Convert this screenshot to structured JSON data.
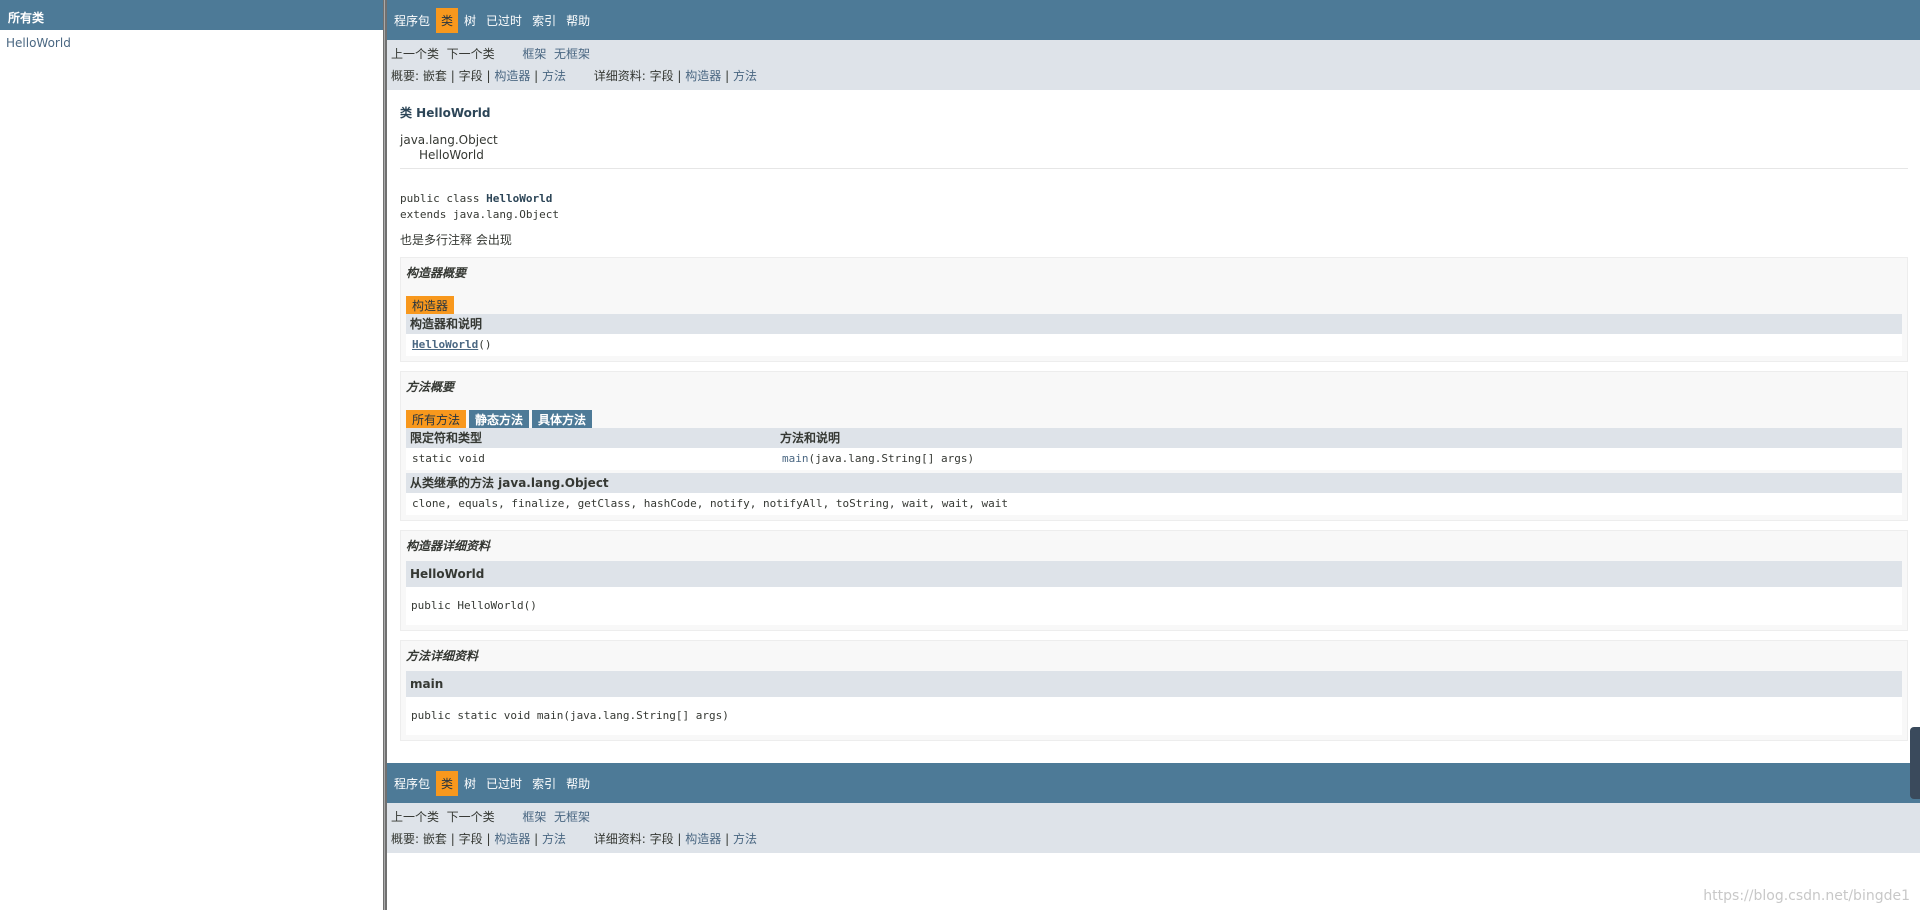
{
  "left": {
    "header": "所有类",
    "classes": [
      "HelloWorld"
    ]
  },
  "nav": {
    "items": [
      "程序包",
      "类",
      "树",
      "已过时",
      "索引",
      "帮助"
    ],
    "active_index": 1,
    "prev_class": "上一个类",
    "next_class": "下一个类",
    "frames": "框架",
    "no_frames": "无框架",
    "summary_label": "概要:",
    "nested": "嵌套",
    "fields": "字段",
    "constructors": "构造器",
    "methods": "方法",
    "detail_label": "详细资料:",
    "sep": "|"
  },
  "class_info": {
    "title": "类 HelloWorld",
    "parent": "java.lang.Object",
    "child": "HelloWorld",
    "sig_line1_prefix": "public class ",
    "sig_name": "HelloWorld",
    "sig_line2": "extends java.lang.Object",
    "description": "也是多行注释 会出现"
  },
  "constructor_summary": {
    "title": "构造器概要",
    "caption": "构造器",
    "col_header": "构造器和说明",
    "row_name": "HelloWorld",
    "row_params": "()"
  },
  "method_summary": {
    "title": "方法概要",
    "tabs": [
      "所有方法",
      "静态方法",
      "具体方法"
    ],
    "col_modifier": "限定符和类型",
    "col_method": "方法和说明",
    "rows": [
      {
        "modifier": "static void",
        "name": "main",
        "params": "(java.lang.String[]  args)"
      }
    ],
    "inherited_header": "从类继承的方法 java.lang.Object",
    "inherited_methods": "clone, equals, finalize, getClass, hashCode, notify, notifyAll, toString, wait, wait, wait"
  },
  "constructor_detail": {
    "title": "构造器详细资料",
    "name": "HelloWorld",
    "signature": "public  HelloWorld()"
  },
  "method_detail": {
    "title": "方法详细资料",
    "name": "main",
    "signature": "public static  void  main(java.lang.String[]  args)"
  },
  "watermark": "https://blog.csdn.net/bingde1",
  "colors": {
    "nav_bg": "#4d7a97",
    "active": "#f8981d",
    "subnav_bg": "#dee3e9",
    "link": "#4a6782"
  }
}
